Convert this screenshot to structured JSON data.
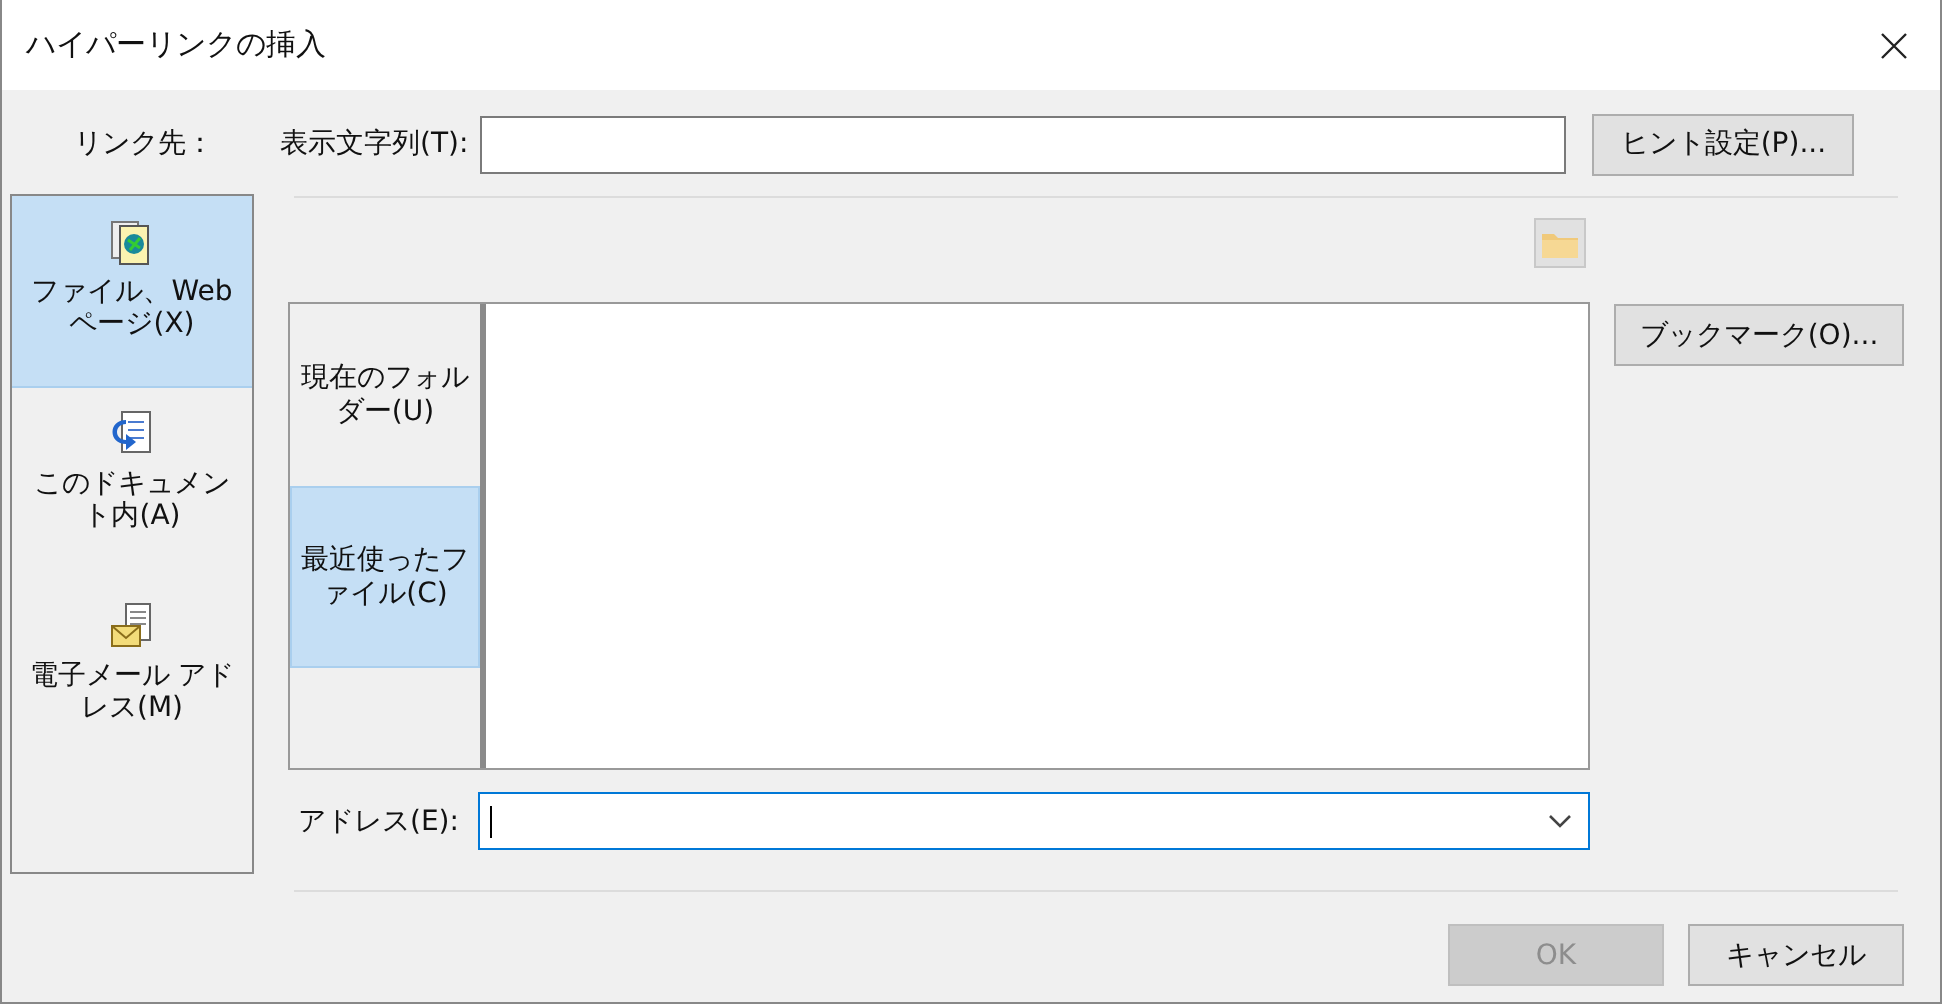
{
  "window": {
    "title": "ハイパーリンクの挿入"
  },
  "link_to_label": "リンク先：",
  "link_targets": [
    {
      "kind": "file",
      "label": "ファイル、Web ページ(X)",
      "selected": true
    },
    {
      "kind": "document",
      "label": "このドキュメント内(A)",
      "selected": false
    },
    {
      "kind": "email",
      "label": "電子メール アドレス(M)",
      "selected": false
    }
  ],
  "display_text": {
    "label": "表示文字列(T):"
  },
  "hint_button": "ヒント設定(P)...",
  "browse_tabs": [
    {
      "label": "現在のフォルダー(U)",
      "selected": false
    },
    {
      "label": "最近使ったファイル(C)",
      "selected": true
    }
  ],
  "bookmark_button": "ブックマーク(O)...",
  "address": {
    "label": "アドレス(E):",
    "focused": true
  },
  "footer_buttons": [
    {
      "label": "OK",
      "disabled": true
    },
    {
      "label": "キャンセル",
      "disabled": false
    }
  ]
}
